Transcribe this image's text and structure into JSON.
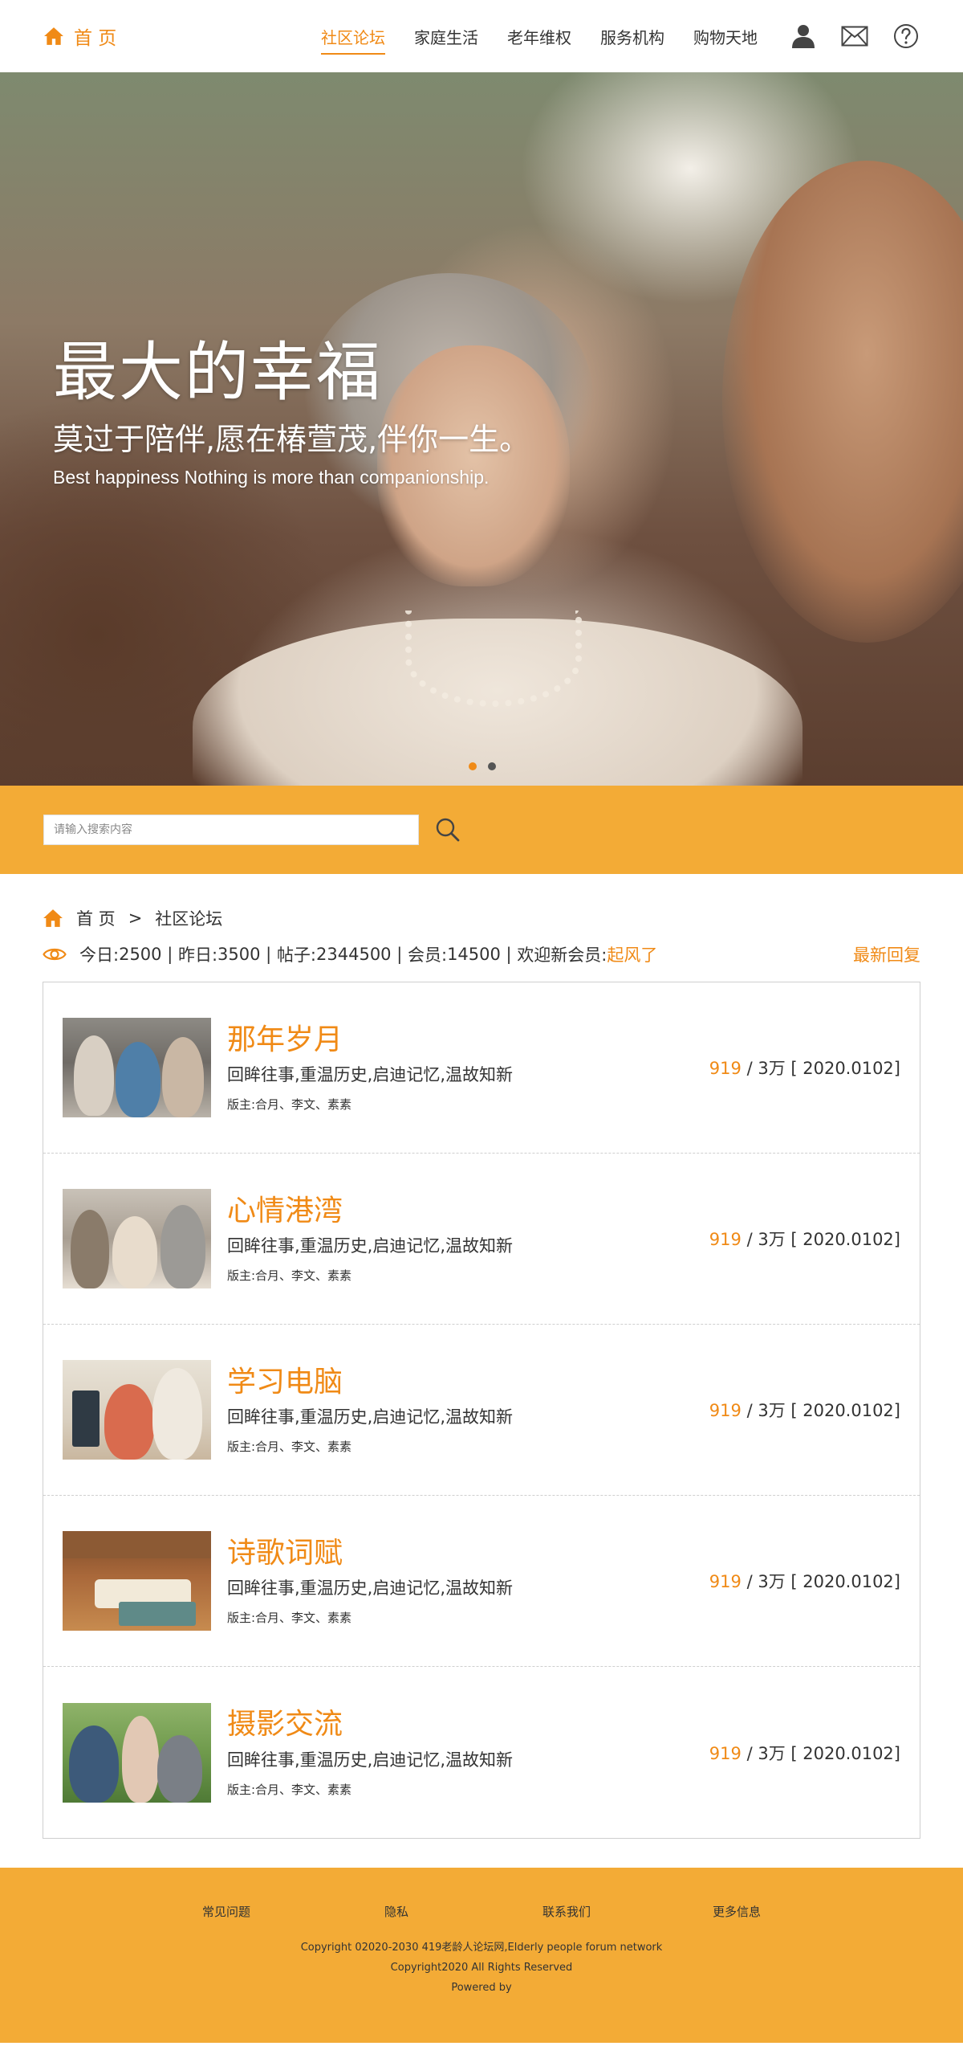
{
  "header": {
    "brand_label": "首 页",
    "nav": [
      {
        "label": "社区论坛",
        "active": true
      },
      {
        "label": "家庭生活",
        "active": false
      },
      {
        "label": "老年维权",
        "active": false
      },
      {
        "label": "服务机构",
        "active": false
      },
      {
        "label": "购物天地",
        "active": false
      }
    ],
    "icons": [
      "user-icon",
      "mail-icon",
      "help-icon"
    ]
  },
  "hero": {
    "title": "最大的幸福",
    "subtitle": "莫过于陪伴,愿在椿萱茂,伴你一生。",
    "english": "Best happiness Nothing is more than companionship.",
    "slides_total": 2,
    "active_slide": 1
  },
  "search": {
    "placeholder": "请输入搜索内容",
    "button_icon": "search-icon"
  },
  "breadcrumb": {
    "home": "首 页",
    "separator": ">",
    "current": "社区论坛"
  },
  "stats": {
    "today_label": "今日:",
    "today": "2500",
    "yesterday_label": "昨日:",
    "yesterday": "3500",
    "posts_label": "帖子:",
    "posts": "2344500",
    "members_label": "会员:",
    "members": "14500",
    "welcome_label": "欢迎新会员:",
    "new_member": "起风了",
    "latest_reply": "最新回复"
  },
  "forums": [
    {
      "name": "那年岁月",
      "desc": "回眸往事,重温历史,启迪记忆,温故知新",
      "mods": "版主:合月、李文、素素",
      "count": "919",
      "total": "/ 3万 [ 2020.0102]",
      "thumb": "party-photo"
    },
    {
      "name": "心情港湾",
      "desc": "回眸往事,重温历史,启迪记忆,温故知新",
      "mods": "版主:合月、李文、素素",
      "count": "919",
      "total": "/ 3万 [ 2020.0102]",
      "thumb": "gathering-photo"
    },
    {
      "name": "学习电脑",
      "desc": "回眸往事,重温历史,启迪记忆,温故知新",
      "mods": "版主:合月、李文、素素",
      "count": "919",
      "total": "/ 3万 [ 2020.0102]",
      "thumb": "computer-photo"
    },
    {
      "name": "诗歌词赋",
      "desc": "回眸往事,重温历史,启迪记忆,温故知新",
      "mods": "版主:合月、李文、素素",
      "count": "919",
      "total": "/ 3万 [ 2020.0102]",
      "thumb": "books-photo"
    },
    {
      "name": "摄影交流",
      "desc": "回眸往事,重温历史,启迪记忆,温故知新",
      "mods": "版主:合月、李文、素素",
      "count": "919",
      "total": "/ 3万 [ 2020.0102]",
      "thumb": "camera-photo"
    }
  ],
  "footer": {
    "links": [
      "常见问题",
      "隐私",
      "联系我们",
      "更多信息"
    ],
    "copy1": "Copyright 02020-2030 419老龄人论坛网,Elderly people forum network",
    "copy2": "Copyright2020 All Rights Reserved",
    "copy3": "Powered by"
  },
  "colors": {
    "accent": "#f08a16",
    "band": "#f3ab36",
    "text": "#333333"
  }
}
